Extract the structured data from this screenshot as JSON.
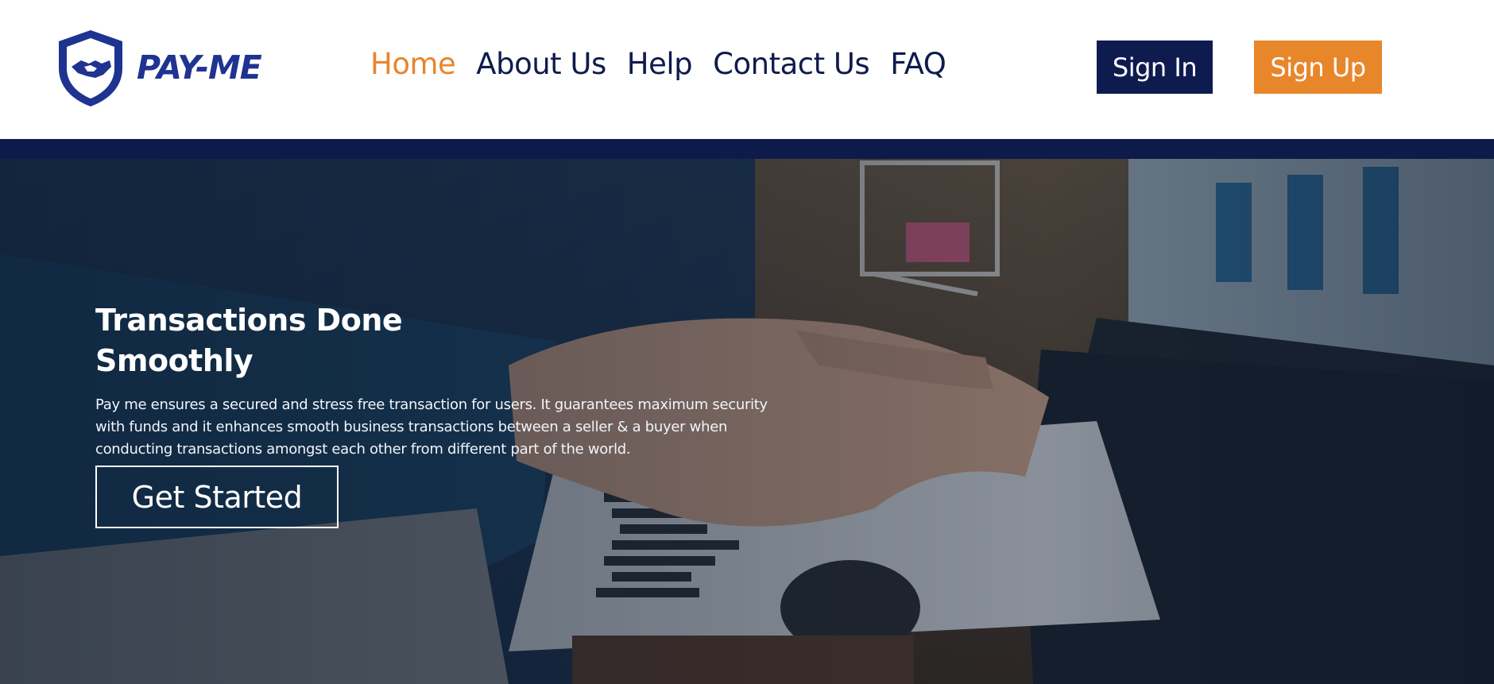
{
  "brand": {
    "name": "PAY-ME",
    "logo_icon": "shield-handshake-icon",
    "color": "#1f3391"
  },
  "nav": {
    "items": [
      {
        "label": "Home",
        "active": true
      },
      {
        "label": "About Us",
        "active": false
      },
      {
        "label": "Help",
        "active": false
      },
      {
        "label": "Contact Us",
        "active": false
      },
      {
        "label": "FAQ",
        "active": false
      }
    ]
  },
  "auth": {
    "sign_in_label": "Sign In",
    "sign_up_label": "Sign Up"
  },
  "colors": {
    "accent": "#e8862a",
    "navy": "#0e1b4f"
  },
  "hero": {
    "title": "Transactions Done Smoothly",
    "description": "Pay me ensures a secured and stress free transaction for users. It guarantees maximum security with funds and it enhances smooth business transactions between a seller & a buyer when conducting transactions amongst each other from different part of the world.",
    "cta_label": "Get Started",
    "background": "handshake-photo"
  }
}
